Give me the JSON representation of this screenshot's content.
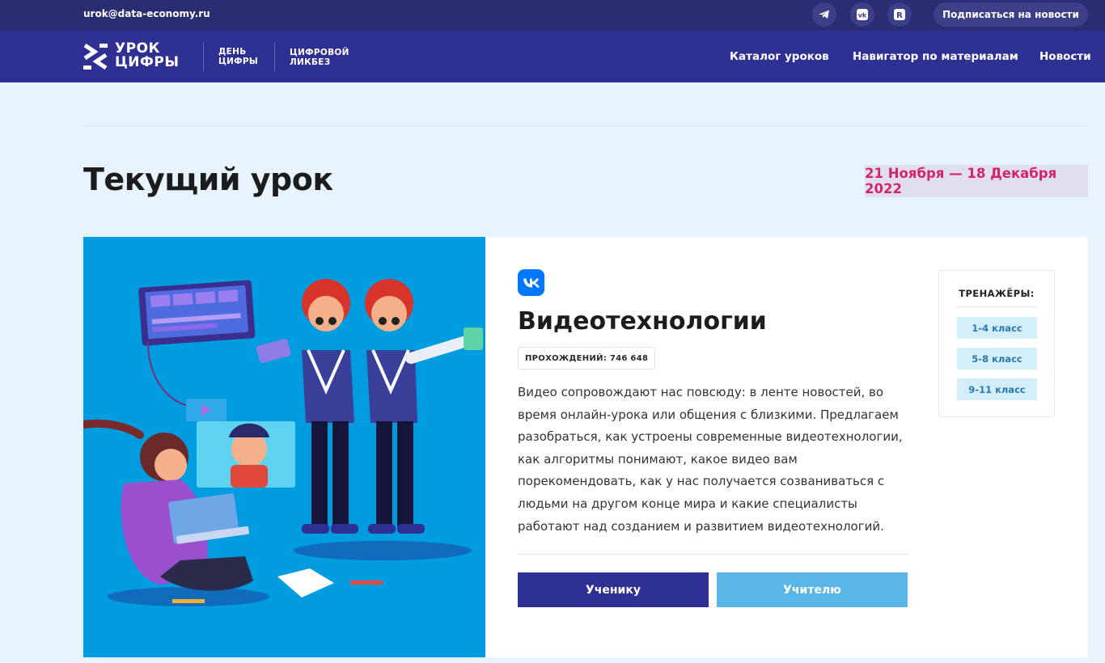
{
  "topbar": {
    "email": "urok@data-economy.ru",
    "subscribe_label": "Подписаться на новости",
    "socials": [
      "telegram-icon",
      "vk-icon",
      "rutube-icon"
    ]
  },
  "navbar": {
    "logo_line1": "УРОК",
    "logo_line2": "ЦИФРЫ",
    "sub1_line1": "ДЕНЬ",
    "sub1_line2": "ЦИФРЫ",
    "sub2_line1": "ЦИФРОВОЙ",
    "sub2_line2": "ЛИКБЕЗ",
    "links": [
      "Каталог уроков",
      "Навигатор по материалам",
      "Новости"
    ]
  },
  "page": {
    "title": "Текущий урок",
    "date_range": "21 Ноября — 18 Декабря 2022"
  },
  "lesson": {
    "partner_icon": "vk-logo-icon",
    "title": "Видеотехнологии",
    "completions": "ПРОХОЖДЕНИЙ: 746 648",
    "description": "Видео сопровождают нас повсюду: в ленте новостей, во время онлайн-урока или общения с близкими. Предлагаем разобраться, как устроены современные видеотехнологии, как алгоритмы понимают, какое видео вам порекомендовать, как у нас получается созваниваться с людьми на другом конце мира и какие специалисты работают над созданием и развитием видеотехнологий.",
    "student_button": "Ученику",
    "teacher_button": "Учителю"
  },
  "trainers": {
    "title": "ТРЕНАЖЁРЫ:",
    "grades": [
      "1-4 класс",
      "5-8 класс",
      "9-11 класс"
    ]
  },
  "colors": {
    "topbar": "#2b2d73",
    "navbar": "#2e3094",
    "accent_date": "#d2256a",
    "illustration_bg": "#009ce0",
    "teacher_button": "#5bb6e8"
  }
}
